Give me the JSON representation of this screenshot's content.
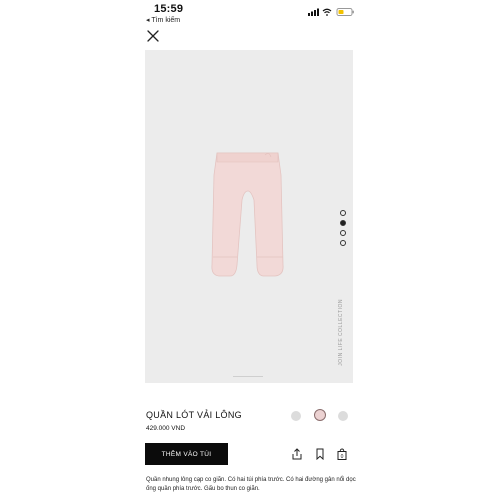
{
  "status_bar": {
    "time": "15:59",
    "back_label": "◂ Tìm kiếm"
  },
  "product": {
    "collection_label": "JOIN LIFE COLLECTION",
    "title": "QUẦN LÓT VẢI LÔNG",
    "price": "429.000 VND",
    "add_to_cart_label": "THÊM VÀO TÚI",
    "bag_count": "0",
    "description": "Quần nhung lông cạp co giãn. Có hai túi phía trước. Có hai đường gân nổi dọc ống quần phía trước. Gấu bo thun co giãn."
  },
  "gallery": {
    "total": 4,
    "active_index": 1
  },
  "colors": {
    "product_pink": "#f2d9d7",
    "background": "#ececec",
    "button": "#0b0b0b"
  },
  "swatches": [
    {
      "name": "grey",
      "color": "#dcdcdc",
      "selected": false
    },
    {
      "name": "pink",
      "color": "#ecd2d2",
      "selected": true
    },
    {
      "name": "grey-light",
      "color": "#dcdcdc",
      "selected": false
    }
  ],
  "icons": [
    "close-icon",
    "share-icon",
    "bookmark-icon",
    "bag-icon",
    "signal-icon",
    "wifi-icon",
    "battery-icon"
  ]
}
